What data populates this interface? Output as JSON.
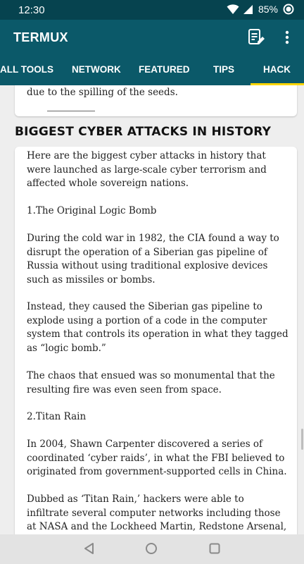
{
  "status": {
    "time": "12:30",
    "battery": "85%"
  },
  "appbar": {
    "title": "TERMUX",
    "actions": [
      "notes-edit-icon",
      "more-vert-icon"
    ]
  },
  "tabs": [
    {
      "label": "ALL TOOLS"
    },
    {
      "label": "NETWORK"
    },
    {
      "label": "FEATURED"
    },
    {
      "label": "TIPS"
    },
    {
      "label": "HACK",
      "selected": true
    }
  ],
  "accent_color": "#ffd600",
  "appbar_color": "#0b5969",
  "previous_card": {
    "tail": "due to the spilling of the seeds."
  },
  "section": {
    "title": "BIGGEST CYBER ATTACKS IN HISTORY"
  },
  "article": {
    "paragraphs": [
      "Here are the biggest cyber attacks in history that were launched as large-scale cyber terrorism and affected whole sovereign nations.",
      "1.The Original Logic Bomb",
      "During the cold war in 1982, the CIA found a way to disrupt the operation of a Siberian gas pipeline of Russia without using traditional explosive devices such as missiles or bombs.",
      "Instead, they caused the Siberian gas pipeline to explode using a portion of a code in the computer system that controls its operation in what they tagged as “logic bomb.”",
      "The chaos that ensued was so monumental that the resulting fire was even seen from space.",
      "2.Titan Rain",
      "In 2004, Shawn Carpenter discovered a series of coordinated ‘cyber raids’, in what the FBI believed to originated from government-supported cells in China.",
      "Dubbed as ‘Titan Rain,’ hackers were able to infiltrate several computer networks including those at NASA and the Lockheed Martin, Redstone Arsenal, and"
    ]
  },
  "navbar": {
    "buttons": [
      "back-icon",
      "home-icon",
      "recents-icon"
    ]
  }
}
